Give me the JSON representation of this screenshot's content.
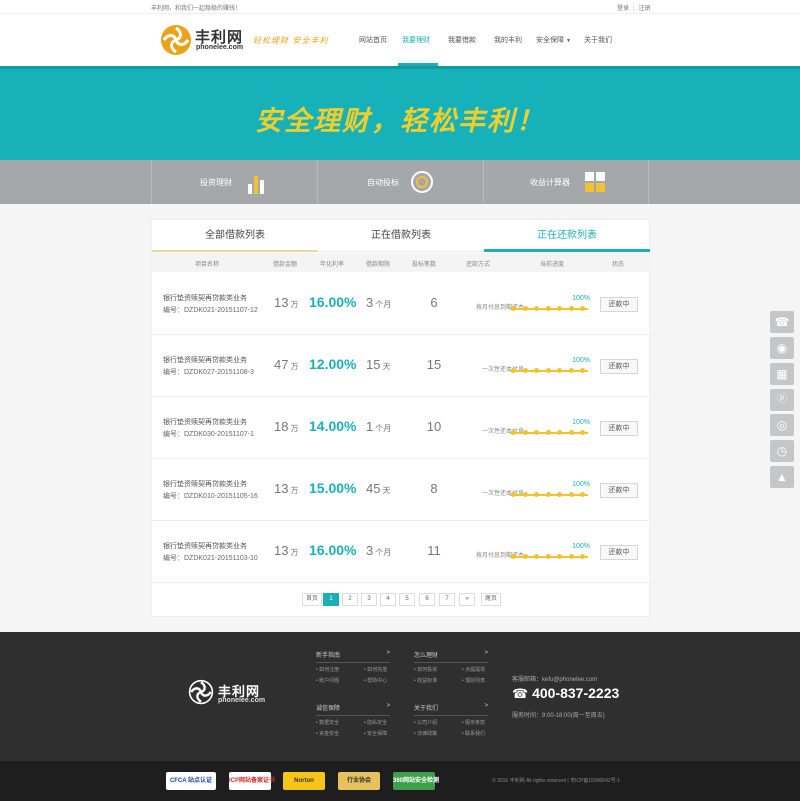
{
  "topbar": {
    "welcome": "丰利网，和我们一起稳稳的赚钱！",
    "login": "登录",
    "register": "注册"
  },
  "header": {
    "logo_name": "丰利网",
    "logo_domain": "phonelee.com",
    "slogan": "轻松理财  安全丰利",
    "nav": [
      "网站首页",
      "我要理财",
      "我要借款",
      "我的丰利",
      "安全保障",
      "关于我们"
    ],
    "active_nav": "我要理财"
  },
  "banner": {
    "title": "安全理财，轻松丰利！"
  },
  "features": [
    "投资理财",
    "自动投标",
    "收益计算器"
  ],
  "tabs": [
    "全部借款列表",
    "正在借款列表",
    "正在还款列表"
  ],
  "active_tab": "正在还款列表",
  "table": {
    "headers": [
      "项目名称",
      "借款金额",
      "年化利率",
      "借款期限",
      "投标笔数",
      "还款方式",
      "当前进度",
      "状态"
    ],
    "rows": [
      {
        "name": "银行垫资赎契再贷款类业务",
        "code": "编号：DZDK021-20151107-12",
        "amount": "13",
        "amount_unit": "万",
        "rate": "16.00%",
        "term": "3",
        "term_unit": "个月",
        "bids": "6",
        "method": "按月付息到期还本",
        "progress_label": "100%",
        "progress": 1.0,
        "status": "还款中"
      },
      {
        "name": "银行垫资赎契再贷款类业务",
        "code": "编号：DZDK027-20151108-3",
        "amount": "47",
        "amount_unit": "万",
        "rate": "12.00%",
        "term": "15",
        "term_unit": "天",
        "bids": "15",
        "method": "一次性还本付息",
        "progress_label": "100%",
        "progress": 1.0,
        "status": "还款中"
      },
      {
        "name": "银行垫资赎契再贷款类业务",
        "code": "编号：DZDK030-20151107-1",
        "amount": "18",
        "amount_unit": "万",
        "rate": "14.00%",
        "term": "1",
        "term_unit": "个月",
        "bids": "10",
        "method": "一次性还本付息",
        "progress_label": "100%",
        "progress": 1.0,
        "status": "还款中"
      },
      {
        "name": "银行垫资赎契再贷款类业务",
        "code": "编号：DZDK010-20151105-16",
        "amount": "13",
        "amount_unit": "万",
        "rate": "15.00%",
        "term": "45",
        "term_unit": "天",
        "bids": "8",
        "method": "一次性还本付息",
        "progress_label": "100%",
        "progress": 1.0,
        "status": "还款中"
      },
      {
        "name": "银行垫资赎契再贷款类业务",
        "code": "编号：DZDK021-20151103-10",
        "amount": "13",
        "amount_unit": "万",
        "rate": "16.00%",
        "term": "3",
        "term_unit": "个月",
        "bids": "11",
        "method": "按月付息到期还本",
        "progress_label": "100%",
        "progress": 1.0,
        "status": "还款中"
      }
    ]
  },
  "pager": [
    "首页",
    "1",
    "2",
    "3",
    "4",
    "5",
    "6",
    "7",
    "»",
    "尾页"
  ],
  "pager_active": "1",
  "side_tools": [
    "phone-icon",
    "qq-icon",
    "qrcode-icon",
    "p-icon",
    "weibo-icon",
    "clock-icon",
    "top-icon"
  ],
  "footer": {
    "logo_name": "丰利网",
    "logo_domain": "phonelee.com",
    "columns": [
      {
        "title": "新手指南",
        "links": [
          "如何注册",
          "如何充值",
          "账户问题",
          "帮助中心"
        ]
      },
      {
        "title": "怎么理财",
        "links": [
          "如何投资",
          "点提提现",
          "收益标准",
          "理财列表"
        ]
      },
      {
        "title": "诚信保障",
        "links": [
          "数据安全",
          "隐私安全",
          "资金安全",
          "安全保障"
        ]
      },
      {
        "title": "关于我们",
        "links": [
          "公司介绍",
          "服务条款",
          "法律政策",
          "联系我们"
        ]
      }
    ],
    "arrow": ">",
    "mail": "客服邮箱：kefu@phonelee.com",
    "phone": "400-837-2223",
    "hours": "服务时间：9:00-18:00(周一至周五)",
    "badges": [
      "CFCA 站点认证",
      "ICP网站备案证书",
      "Norton",
      "行业协会",
      "360网站安全检测"
    ],
    "copyright": "© 2015 丰利网 All rights reserved | 粤ICP备15000642号-1"
  },
  "colors": {
    "accent": "#1bb0b8",
    "gold": "#f2c230",
    "footer": "#2f2f2f"
  }
}
